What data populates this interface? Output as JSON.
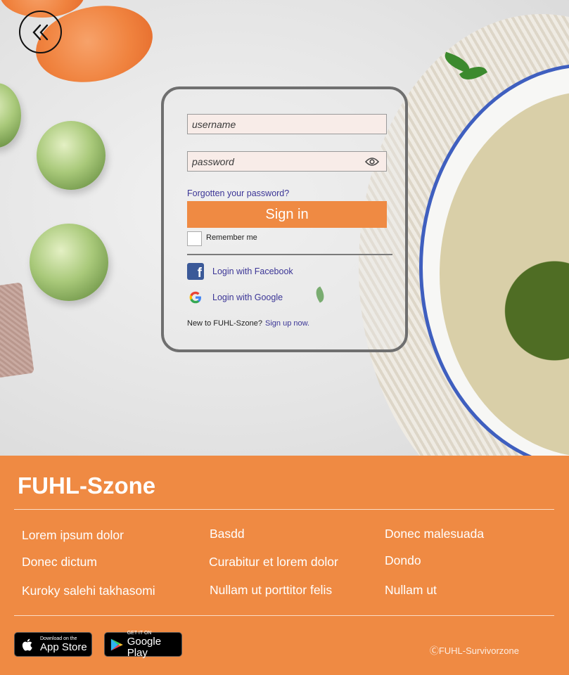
{
  "login": {
    "username_placeholder": "username",
    "password_placeholder": "password",
    "forgot_link": "Forgotten your password?",
    "signin_label": "Sign in",
    "remember_label": "Remember me",
    "facebook_label": "Login with Facebook",
    "google_label": "Login with Google",
    "new_prompt": "New to FUHL-Szone?",
    "signup_link": "Sign up now."
  },
  "footer": {
    "brand": "FUHL-Szone",
    "links": {
      "col1": [
        "Lorem ipsum dolor",
        "Donec dictum",
        "Kuroky salehi takhasomi"
      ],
      "col2": [
        "Basdd",
        "Curabitur et lorem dolor",
        "Nullam ut porttitor felis"
      ],
      "col3": [
        "Donec malesuada",
        "Dondo",
        "Nullam ut"
      ]
    },
    "app_store": {
      "small": "Download on the",
      "big": "App Store"
    },
    "google_play": {
      "small": "GET IT ON",
      "big": "Google Play"
    },
    "copyright": "ⒸFUHL-Survivorzone"
  },
  "colors": {
    "accent": "#ef8a43",
    "link": "#3b3596",
    "card_border": "#6f6f6f",
    "input_bg": "#f8ece8"
  },
  "icons": [
    "back-double-chevron-icon",
    "eye-icon",
    "facebook-icon",
    "google-icon",
    "apple-icon",
    "google-play-icon"
  ]
}
